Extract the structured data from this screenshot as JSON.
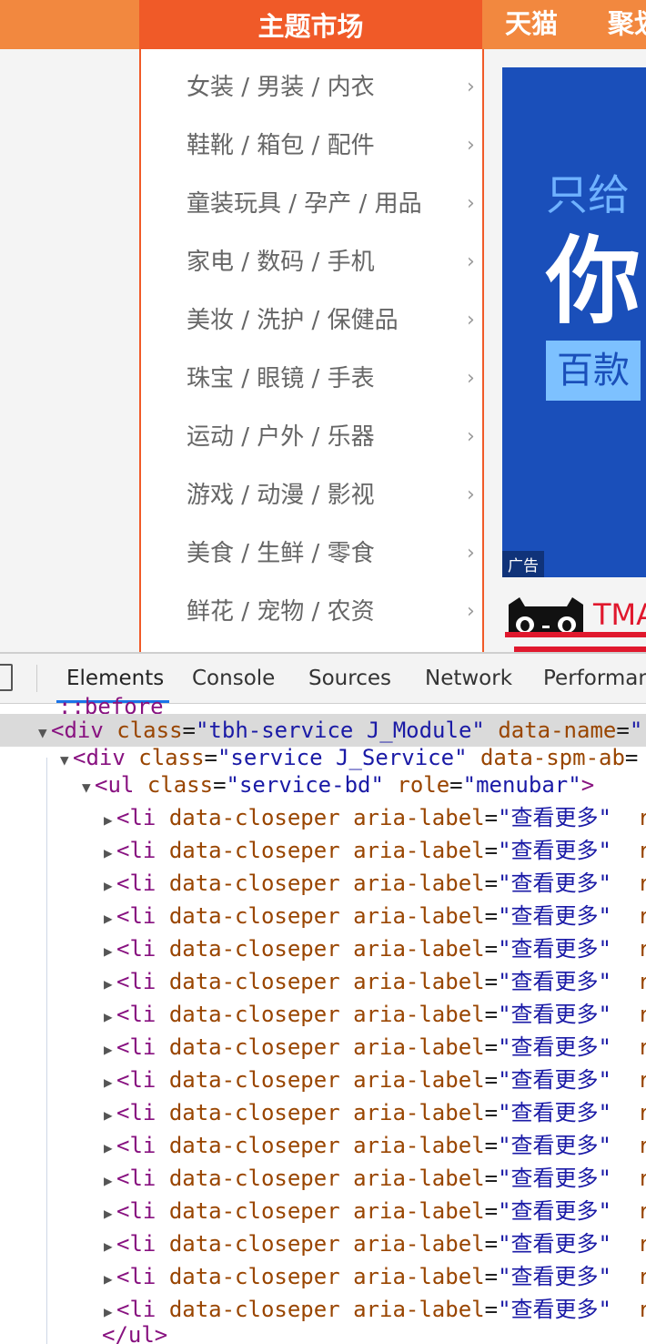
{
  "nav": {
    "main": "主题市场",
    "links": [
      "天猫",
      "聚划"
    ]
  },
  "categories": [
    "女装 / 男装 / 内衣",
    "鞋靴 / 箱包 / 配件",
    "童装玩具 / 孕产 / 用品",
    "家电 / 数码 / 手机",
    "美妆 / 洗护 / 保健品",
    "珠宝 / 眼镜 / 手表",
    "运动 / 户外 / 乐器",
    "游戏 / 动漫 / 影视",
    "美食 / 生鲜 / 零食",
    "鲜花 / 宠物 / 农资"
  ],
  "banner": {
    "line1": "只给",
    "line2": "你",
    "line3": "百款",
    "ad_label": "广告"
  },
  "tmall": {
    "text": "TMA"
  },
  "devtools": {
    "tabs": [
      "Elements",
      "Console",
      "Sources",
      "Network",
      "Performan"
    ],
    "active_tab": "Elements",
    "pseudo_line": "::before",
    "div1": {
      "tag": "div",
      "class_attr": "class",
      "class_val": "tbh-service J_Module",
      "extra_attr": "data-name"
    },
    "div2": {
      "tag": "div",
      "class_attr": "class",
      "class_val": "service J_Service",
      "extra_attr": "data-spm-ab"
    },
    "ul": {
      "tag": "ul",
      "class_attr": "class",
      "class_val": "service-bd",
      "role_attr": "role",
      "role_val": "menubar"
    },
    "li": {
      "tag": "li",
      "attr1": "data-closeper",
      "attr2": "aria-label",
      "val2": "查看更多",
      "trail": "r"
    },
    "li_count": 16,
    "closing": "</ul>"
  },
  "colors": {
    "nav_orange": "#f2883f",
    "nav_main": "#f05a28",
    "banner_blue": "#1a4fba",
    "tmall_red": "#e0182d",
    "tag": "#881280",
    "attr": "#994500",
    "val": "#1a1aa6"
  }
}
